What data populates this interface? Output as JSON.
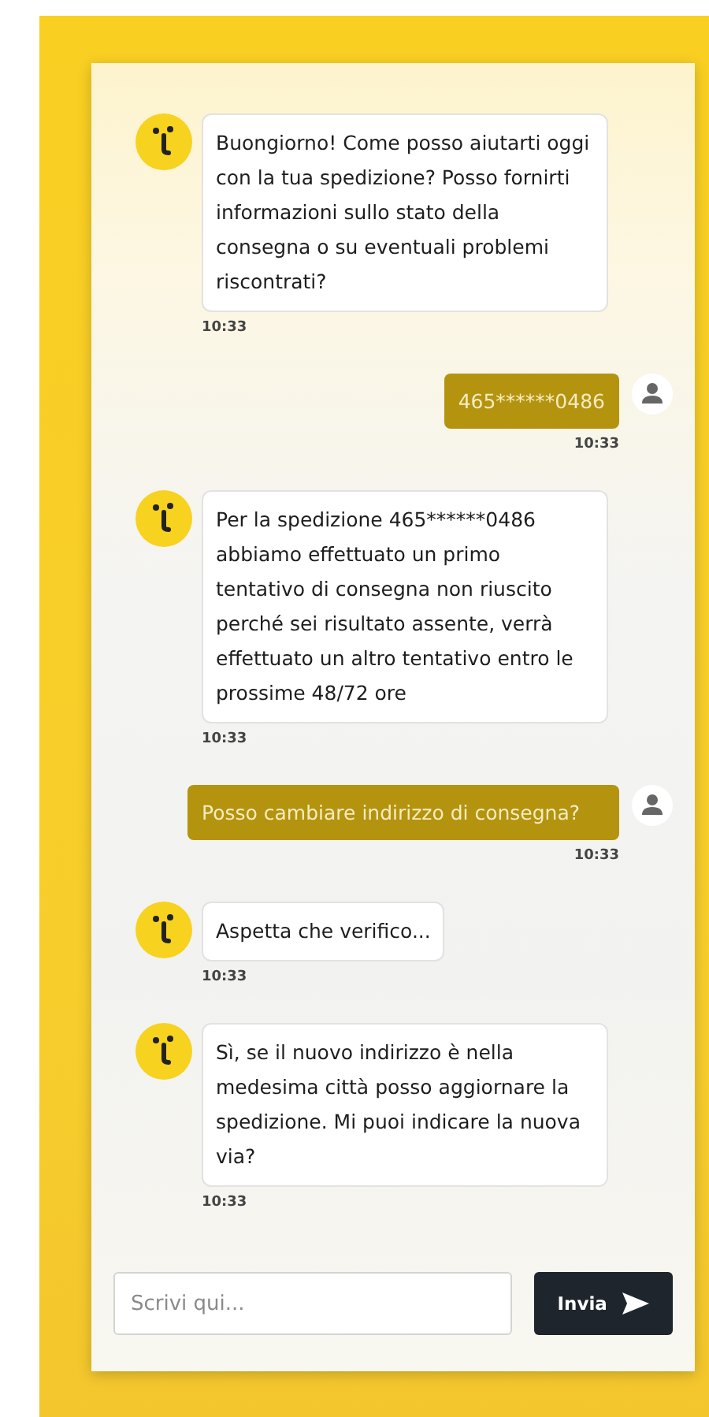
{
  "messages": [
    {
      "kind": "bot",
      "text": "Buongiorno! Come posso aiutarti oggi con la tua spedizione? Posso fornirti informazioni sullo stato della consegna o su eventuali problemi riscontrati?",
      "time": "10:33"
    },
    {
      "kind": "user",
      "text": "465******0486",
      "time": "10:33"
    },
    {
      "kind": "bot",
      "text": "Per la spedizione 465******0486 abbiamo effettuato un primo tentativo di consegna non riuscito perché sei risultato assente, verrà effettuato un altro tentativo entro le prossime 48/72 ore",
      "time": "10:33"
    },
    {
      "kind": "user",
      "text": "Posso cambiare indirizzo di consegna?",
      "time": "10:33"
    },
    {
      "kind": "bot",
      "text": "Aspetta che verifico...",
      "time": "10:33"
    },
    {
      "kind": "bot",
      "text": "Sì, se il nuovo indirizzo è nella medesima città posso aggiornare la spedizione. Mi puoi indicare la nuova via?",
      "time": "10:33"
    }
  ],
  "composer": {
    "placeholder": "Scrivi qui...",
    "send_label": "Invia"
  }
}
